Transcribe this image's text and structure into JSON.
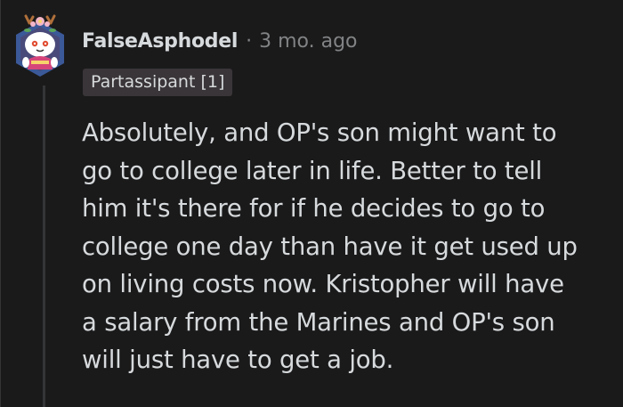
{
  "comment": {
    "author": "FalseAsphodel",
    "separator": "·",
    "timestamp": "3 mo. ago",
    "flair": "Partassipant [1]",
    "body": "Absolutely, and OP's son might want to\ngo to college later in life. Better to tell\nhim it's there for if he decides to go to\ncollege one day than have it get used up\non living costs now. Kristopher will have\na salary from the Marines and OP's son\nwill just have to get a job."
  },
  "colors": {
    "background": "#1a1a1b",
    "text": "#d7dadc",
    "meta": "#818384",
    "flair_bg": "#3a3538",
    "thread_line": "#343536"
  },
  "icons": {
    "avatar": "snoo-avatar-icon"
  }
}
